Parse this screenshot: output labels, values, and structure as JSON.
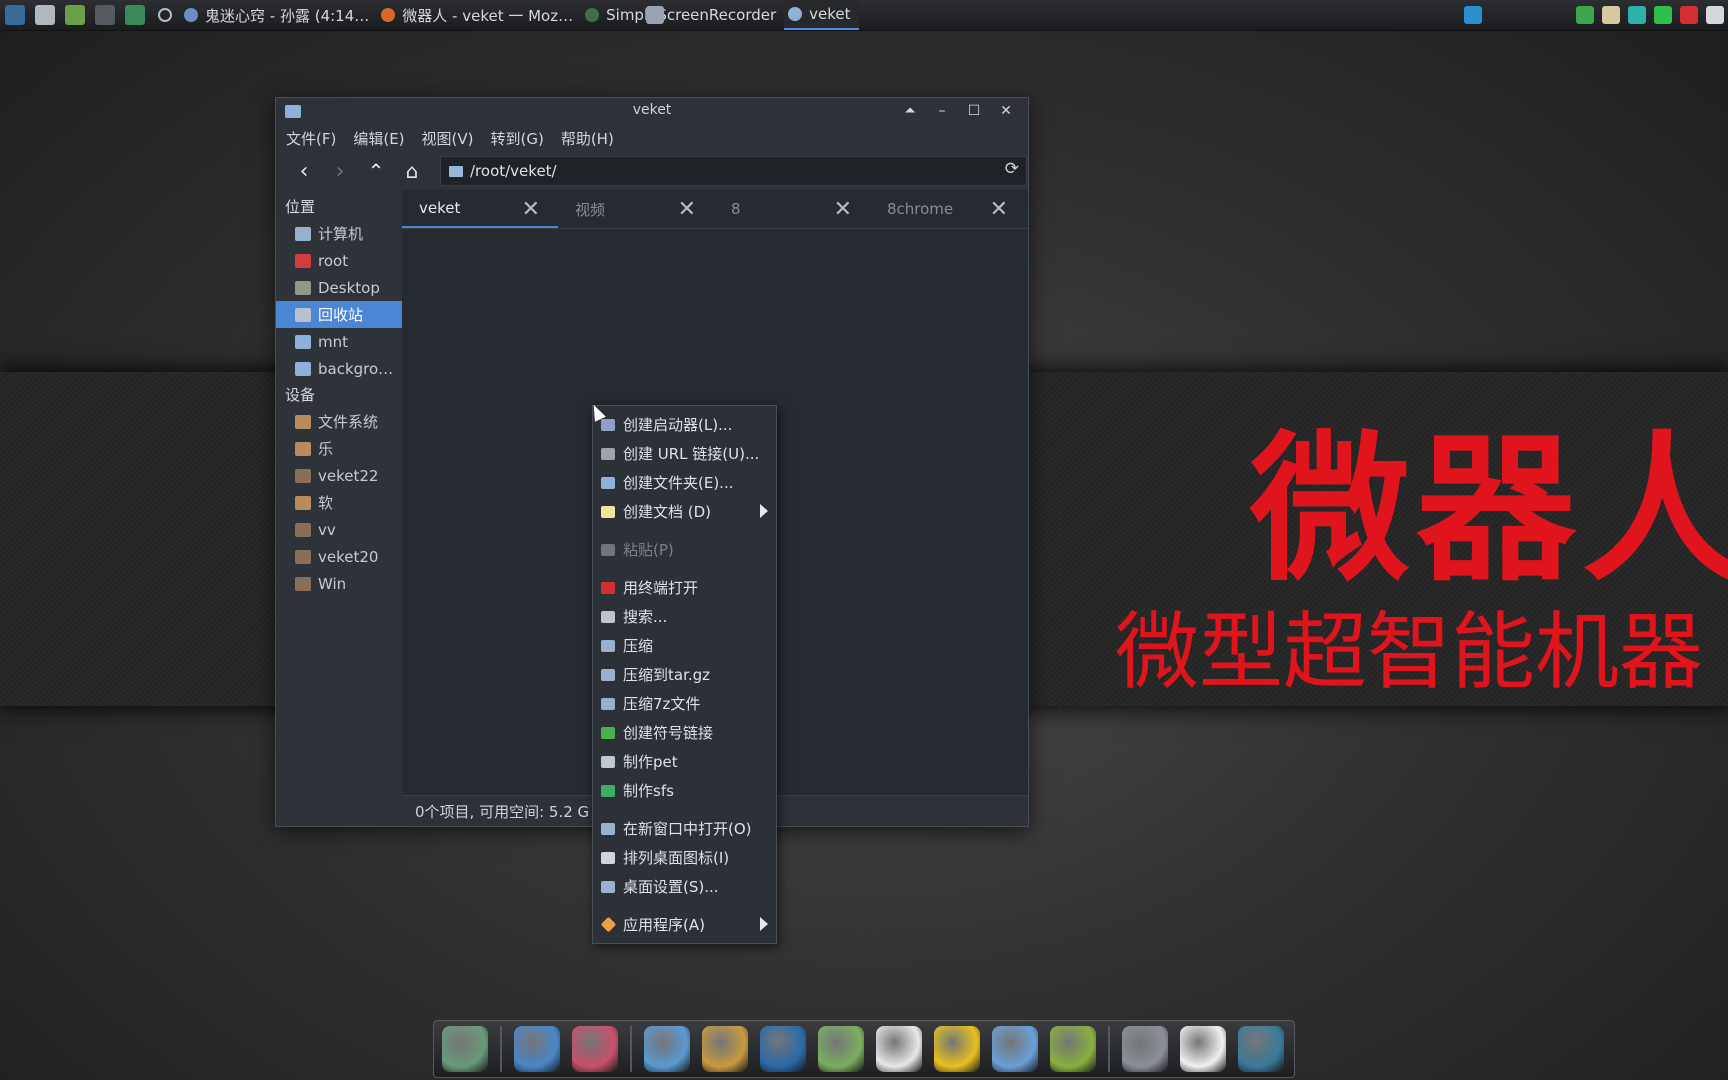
{
  "taskbar": {
    "launchers": [
      "system-monitor-icon",
      "settings-tool-icon",
      "media-play-icon",
      "terminal-icon",
      "globe-icon",
      "record-dot-icon"
    ],
    "tasks": [
      {
        "label": "鬼迷心窍 - 孙露 (4:14…",
        "icon": "music-icon",
        "color": "#6a8fc0",
        "active": false
      },
      {
        "label": "微器人 - veket 一 Moz…",
        "icon": "firefox-icon",
        "color": "#d9692a",
        "active": false
      },
      {
        "label": "SimpleScreenRecorder",
        "icon": "recorder-icon",
        "color": "#3f6f4f",
        "active": false
      },
      {
        "label": "veket",
        "icon": "folder-icon",
        "color": "#8fb0d8",
        "active": true
      }
    ],
    "tray": [
      {
        "icon": "network-monitor-icon",
        "color": "#2a8fd0"
      },
      {
        "icon": "window-icon",
        "color": "#9aa4b0"
      },
      {
        "icon": "shield-icon",
        "color": "#3aa84a"
      },
      {
        "icon": "clipboard-icon",
        "color": "#d8c9a0"
      },
      {
        "icon": "network-icon",
        "color": "#2fb0a8"
      },
      {
        "icon": "battery-icon",
        "color": "#2fc04a"
      },
      {
        "icon": "power-icon",
        "color": "#d23030"
      },
      {
        "icon": "keyboard-icon",
        "color": "#d5d8dc"
      }
    ]
  },
  "desktop": {
    "banner_title": "微器人",
    "banner_subtitle": "微型超智能机器"
  },
  "window": {
    "title": "veket",
    "buttons": [
      "⏶",
      "–",
      "☐",
      "✕"
    ],
    "menu": [
      "文件(F)",
      "编辑(E)",
      "视图(V)",
      "转到(G)",
      "帮助(H)"
    ],
    "path": "/root/veket/",
    "sidebar": {
      "places_heading": "位置",
      "places": [
        {
          "label": "计算机",
          "icon": "computer-icon",
          "color": "#9ab0cf",
          "selected": false
        },
        {
          "label": "root",
          "icon": "home-icon",
          "color": "#d23c3c",
          "selected": false
        },
        {
          "label": "Desktop",
          "icon": "desktop-folder-icon",
          "color": "#8f9a86",
          "selected": false
        },
        {
          "label": "回收站",
          "icon": "trash-icon",
          "color": "#b9c2cc",
          "selected": true
        },
        {
          "label": "mnt",
          "icon": "folder-icon",
          "color": "#8fb0d8",
          "selected": false
        },
        {
          "label": "backgro…",
          "icon": "folder-icon",
          "color": "#8fb0d8",
          "selected": false
        }
      ],
      "devices_heading": "设备",
      "devices": [
        {
          "label": "文件系统",
          "icon": "drive-icon",
          "color": "#b98a5a"
        },
        {
          "label": "乐",
          "icon": "drive-icon",
          "color": "#b98a5a"
        },
        {
          "label": "veket22",
          "icon": "drive-icon",
          "color": "#8a6f58"
        },
        {
          "label": "软",
          "icon": "drive-icon",
          "color": "#b98a5a"
        },
        {
          "label": "vv",
          "icon": "drive-icon",
          "color": "#8a6f58"
        },
        {
          "label": "veket20",
          "icon": "drive-icon",
          "color": "#8a6f58"
        },
        {
          "label": "Win",
          "icon": "drive-icon",
          "color": "#8a6f58"
        }
      ]
    },
    "tabs": [
      {
        "label": "veket",
        "active": true
      },
      {
        "label": "视频",
        "active": false
      },
      {
        "label": "8",
        "active": false
      },
      {
        "label": "8chrome",
        "active": false
      }
    ],
    "status": "0个项目, 可用空间: 5.2 G"
  },
  "context_menu": {
    "items": [
      {
        "label": "创建启动器(L)...",
        "icon": "launcher-icon",
        "color": "#8fa0c8"
      },
      {
        "label": "创建 URL 链接(U)...",
        "icon": "link-icon",
        "color": "#a0a4aa"
      },
      {
        "label": "创建文件夹(E)...",
        "icon": "folder-icon",
        "color": "#8fb0d8"
      },
      {
        "label": "创建文档 (D)",
        "icon": "document-icon",
        "color": "#f0e6a0",
        "submenu": true
      },
      {
        "sep": true
      },
      {
        "label": "粘贴(P)",
        "icon": "paste-icon",
        "color": "#6f747b",
        "disabled": true
      },
      {
        "sep": true
      },
      {
        "label": "用终端打开",
        "icon": "terminal-icon",
        "color": "#d03030"
      },
      {
        "label": "搜索...",
        "icon": "search-icon",
        "color": "#c0c4ca"
      },
      {
        "label": "压缩",
        "icon": "archive-icon",
        "color": "#9ab0cf"
      },
      {
        "label": "压缩到tar.gz",
        "icon": "archive-icon",
        "color": "#9ab0cf"
      },
      {
        "label": "压缩7z文件",
        "icon": "archive-icon",
        "color": "#9ab0cf"
      },
      {
        "label": "创建符号链接",
        "icon": "symlink-icon",
        "color": "#4caf50"
      },
      {
        "label": "制作pet",
        "icon": "package-icon",
        "color": "#c0c8d4"
      },
      {
        "label": "制作sfs",
        "icon": "sfs-icon",
        "color": "#3ab060"
      },
      {
        "sep": true
      },
      {
        "label": "在新窗口中打开(O)",
        "icon": "new-window-icon",
        "color": "#9ab0cf"
      },
      {
        "label": "排列桌面图标(I)",
        "icon": "sort-icon",
        "color": "#d0d4da"
      },
      {
        "label": "桌面设置(S)...",
        "icon": "desktop-settings-icon",
        "color": "#9ab0cf"
      },
      {
        "sep": true
      },
      {
        "label": "应用程序(A)",
        "icon": "apps-icon",
        "color": "#f0a040",
        "submenu": true
      }
    ]
  },
  "dock": {
    "items": [
      {
        "icon": "file-manager-dock-icon",
        "color": "#6a9a7a"
      },
      {
        "sep": true
      },
      {
        "icon": "monitor-dock-icon",
        "color": "#4a86c8"
      },
      {
        "icon": "firefox-dock-icon",
        "color": "#c8506a"
      },
      {
        "sep": true
      },
      {
        "icon": "editor-dock-icon",
        "color": "#5a9ad0"
      },
      {
        "icon": "paint-dock-icon",
        "color": "#c89a40"
      },
      {
        "icon": "media-player-dock-icon",
        "color": "#2a6aa8"
      },
      {
        "icon": "users-dock-icon",
        "color": "#7ab060"
      },
      {
        "icon": "qq-dock-icon",
        "color": "#e8e8e8"
      },
      {
        "icon": "notes-dock-icon",
        "color": "#e8c020"
      },
      {
        "icon": "chart-dock-icon",
        "color": "#6aa0d8"
      },
      {
        "icon": "help-dock-icon",
        "color": "#8ab040"
      },
      {
        "sep": true
      },
      {
        "icon": "drive-dock-icon",
        "color": "#8a9098"
      },
      {
        "icon": "brightness-dock-icon",
        "color": "#f0f0f0"
      },
      {
        "icon": "globe-dock-icon",
        "color": "#3a7a9a"
      }
    ]
  }
}
